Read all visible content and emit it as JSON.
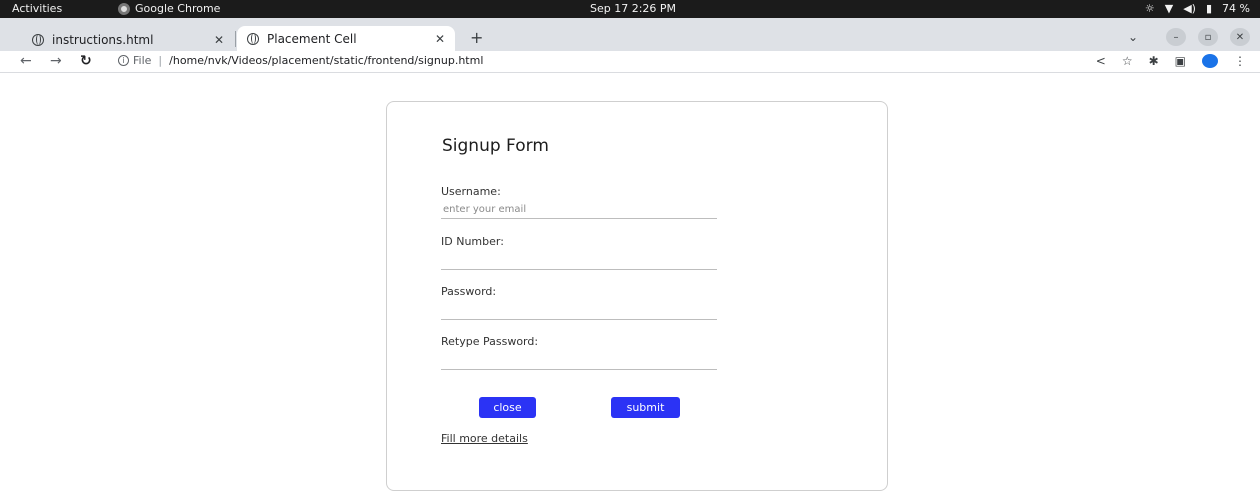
{
  "system_bar": {
    "activities": "Activities",
    "app_name": "Google Chrome",
    "clock": "Sep 17  2:26 PM",
    "battery": "74 %"
  },
  "browser": {
    "tabs": [
      {
        "label": "instructions.html",
        "active": false
      },
      {
        "label": "Placement Cell",
        "active": true
      }
    ],
    "address": {
      "scheme_label": "File",
      "url": "/home/nvk/Videos/placement/static/frontend/signup.html"
    }
  },
  "form": {
    "title": "Signup Form",
    "fields": [
      {
        "label": "Username:",
        "value": "",
        "placeholder": "enter your email"
      },
      {
        "label": "ID Number:",
        "value": "",
        "placeholder": ""
      },
      {
        "label": "Password:",
        "value": "",
        "placeholder": ""
      },
      {
        "label": "Retype Password:",
        "value": "",
        "placeholder": ""
      }
    ],
    "close_label": "close",
    "submit_label": "submit",
    "more_link": "Fill more details",
    "button_color": "#2b33f5"
  }
}
